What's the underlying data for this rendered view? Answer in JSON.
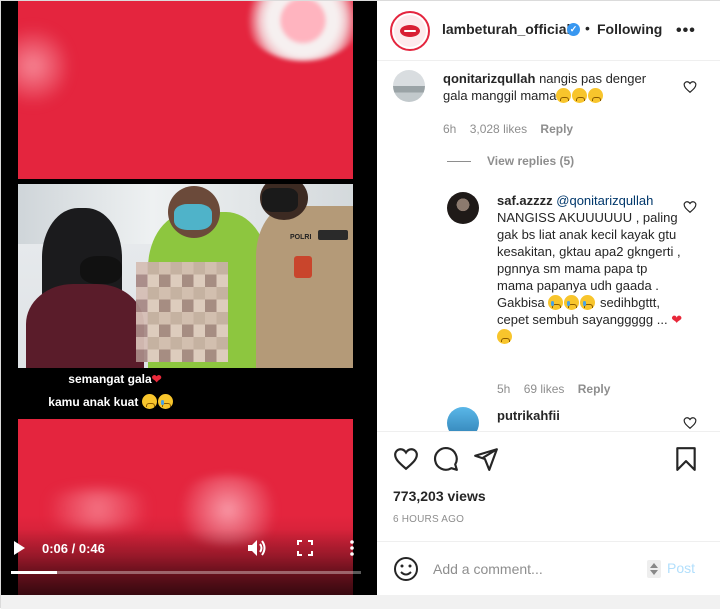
{
  "video": {
    "caption_line1": "semangat gala",
    "caption_line2": "kamu anak kuat",
    "time": "0:06 / 0:46",
    "progress": 0.13,
    "police_label": "POLRI"
  },
  "post": {
    "username": "lambeturah_official",
    "separator": "•",
    "follow_status": "Following",
    "views": "773,203 views",
    "time_ago": "6 HOURS AGO"
  },
  "comments": [
    {
      "username": "qonitarizqullah",
      "text": "nangis pas denger gala manggil mama",
      "age": "6h",
      "likes": "3,028 likes",
      "reply_label": "Reply",
      "view_replies": "View replies (5)"
    },
    {
      "username": "saf.azzzz",
      "mention": "@qonitarizqullah",
      "text": "NANGISS AKUUUUUU , paling gak bs liat anak kecil kayak gtu kesakitan, gktau apa2 gkngerti , pgnnya sm mama papa tp mama papanya udh gaada . Gakbisa",
      "text2": "sedihbgttt, cepet sembuh sayanggggg ...",
      "age": "5h",
      "likes": "69 likes",
      "reply_label": "Reply"
    },
    {
      "username": "putrikahfii"
    }
  ],
  "composer": {
    "placeholder": "Add a comment...",
    "post_label": "Post"
  },
  "colors": {
    "accent_red": "#e4253e",
    "link_blue": "#00376b",
    "verified_blue": "#3897f0",
    "post_disabled": "#b2dffc"
  }
}
